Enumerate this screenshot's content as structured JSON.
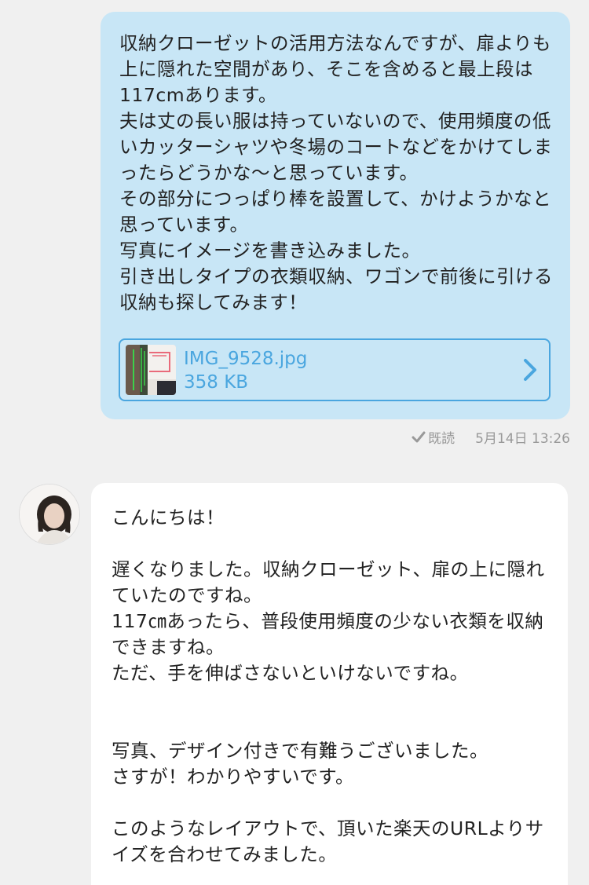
{
  "outgoing": {
    "text": "収納クローゼットの活用方法なんですが、扉よりも上に隠れた空間があり、そこを含めると最上段は117cmあります。\n夫は丈の長い服は持っていないので、使用頻度の低いカッターシャツや冬場のコートなどをかけてしまったらどうかな～と思っています。\nその部分につっぱり棒を設置して、かけようかなと思っています。\n写真にイメージを書き込みました。\n引き出しタイプの衣類収納、ワゴンで前後に引ける収納も探してみます！",
    "attachment": {
      "filename": "IMG_9528.jpg",
      "size": "358 KB"
    },
    "read_label": "既読",
    "timestamp": "5月14日 13:26"
  },
  "incoming": {
    "text": "こんにちは！\n\n遅くなりました。収納クローゼット、扉の上に隠れていたのですね。\n117㎝あったら、普段使用頻度の少ない衣類を収納できますね。\nただ、手を伸ばさないといけないですね。\n\n\n写真、デザイン付きで有難うございました。\nさすが！わかりやすいです。\n\nこのようなレイアウトで、頂いた楽天のURLよりサイズを合わせてみました。"
  },
  "colors": {
    "outgoing_bubble": "#c8e6f6",
    "incoming_bubble": "#ffffff",
    "accent": "#4aa6df",
    "background": "#f0f0f0",
    "meta_text": "#999999"
  },
  "icons": {
    "attachment_chevron": "chevron-right-icon",
    "read_check": "check-icon"
  }
}
